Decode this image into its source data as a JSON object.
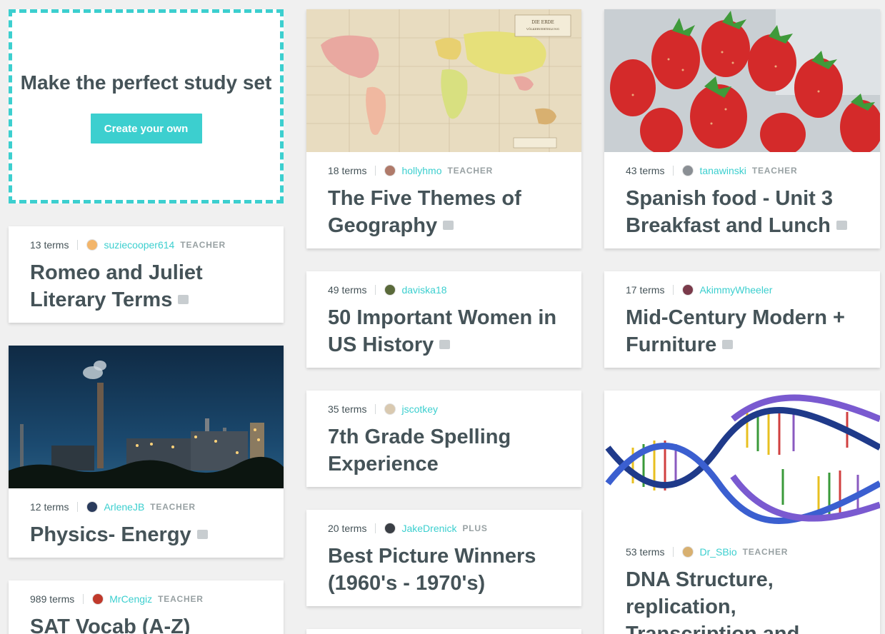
{
  "promo": {
    "heading": "Make the perfect study set",
    "button": "Create your own"
  },
  "sets": [
    {
      "terms": "13 terms",
      "user": "suziecooper614",
      "badge": "TEACHER",
      "title": "Romeo and Juliet Literary Terms"
    },
    {
      "terms": "12 terms",
      "user": "ArleneJB",
      "badge": "TEACHER",
      "title": "Physics- Energy"
    },
    {
      "terms": "989 terms",
      "user": "MrCengiz",
      "badge": "TEACHER",
      "title": "SAT Vocab (A-Z)"
    },
    {
      "terms": "18 terms",
      "user": "hollyhmo",
      "badge": "TEACHER",
      "title": "The Five Themes of Geography"
    },
    {
      "terms": "49 terms",
      "user": "daviska18",
      "badge": "",
      "title": "50 Important Women in US History"
    },
    {
      "terms": "35 terms",
      "user": "jscotkey",
      "badge": "",
      "title": "7th Grade Spelling Experience"
    },
    {
      "terms": "20 terms",
      "user": "JakeDrenick",
      "badge": "PLUS",
      "title": "Best Picture Winners (1960's - 1970's)"
    },
    {
      "terms": "43 terms",
      "user": "tanawinski",
      "badge": "TEACHER",
      "title": "Spanish food - Unit 3 Breakfast and Lunch"
    },
    {
      "terms": "17 terms",
      "user": "AkimmyWheeler",
      "badge": "",
      "title": "Mid-Century Modern + Furniture"
    },
    {
      "terms": "53 terms",
      "user": "Dr_SBio",
      "badge": "TEACHER",
      "title": "DNA Structure, replication, Transcription and"
    }
  ],
  "colors": {
    "accent": "#3ccfcf",
    "text": "#455358",
    "background": "#f0f0f0"
  }
}
